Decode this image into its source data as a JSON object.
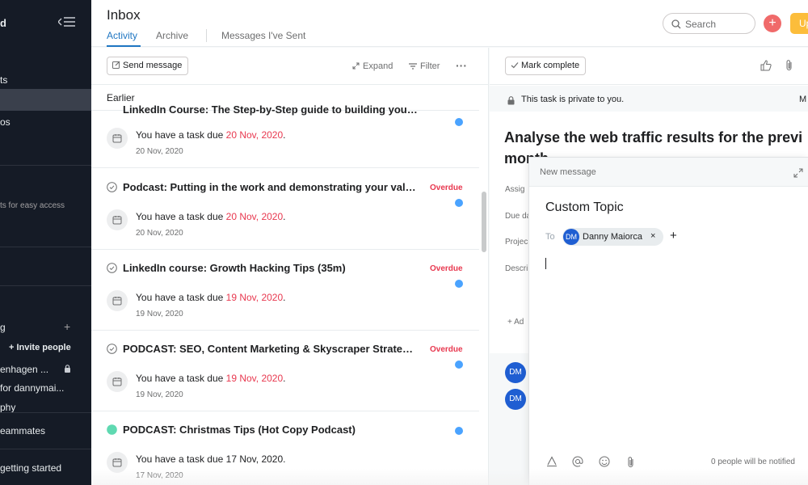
{
  "sidebar": {
    "partial_1": "d",
    "partial_2": "ts",
    "partial_3": "os",
    "partial_4": "ts for easy access",
    "partial_5": "g",
    "invite_label": "Invite people",
    "partial_6": "enhagen ...",
    "partial_7": "for dannymai...",
    "partial_8": "phy",
    "partial_9": "eammates",
    "partial_10": "getting started"
  },
  "header": {
    "title": "Inbox",
    "tabs": [
      {
        "label": "Activity"
      },
      {
        "label": "Archive"
      },
      {
        "label": "Messages I've Sent"
      }
    ],
    "search_placeholder": "Search",
    "upgrade_label": "Up"
  },
  "list_toolbar": {
    "send_message": "Send message",
    "expand": "Expand",
    "filter": "Filter",
    "more": "···"
  },
  "list": {
    "section_label": "Earlier",
    "items": [
      {
        "title": "LinkedIn Course: The Step-by-Step guide to building your li...",
        "overdue": "",
        "text_prefix": "You have a task due ",
        "due": "20 Nov, 2020",
        "text_suffix": ".",
        "date": "20 Nov, 2020"
      },
      {
        "title": "Podcast: Putting in the work and demonstrating your valu...",
        "overdue": "Overdue",
        "text_prefix": "You have a task due ",
        "due": "20 Nov, 2020",
        "text_suffix": ".",
        "date": "20 Nov, 2020"
      },
      {
        "title": "LinkedIn course: Growth Hacking Tips (35m)",
        "overdue": "Overdue",
        "text_prefix": "You have a task due ",
        "due": "19 Nov, 2020",
        "text_suffix": ".",
        "date": "19 Nov, 2020"
      },
      {
        "title": "PODCAST: SEO, Content Marketing & Skyscraper Strategi...",
        "overdue": "Overdue",
        "text_prefix": "You have a task due ",
        "due": "19 Nov, 2020",
        "text_suffix": ".",
        "date": "19 Nov, 2020"
      },
      {
        "title": "PODCAST: Christmas Tips (Hot Copy Podcast)",
        "overdue": "",
        "text_prefix": "You have a task due 17 Nov, 2020.",
        "due": "",
        "text_suffix": "",
        "date": "17 Nov, 2020"
      }
    ]
  },
  "detail": {
    "mark_complete": "Mark complete",
    "private_notice": "This task is private to you.",
    "private_right": "M",
    "title_line1": "Analyse the web traffic results for the previ",
    "title_line2": "month",
    "fields": [
      "Assig",
      "Due da",
      "Projec",
      "Descri"
    ],
    "add_label": "Ad",
    "avatar_initials": "DM"
  },
  "compose": {
    "header": "New message",
    "subject": "Custom Topic",
    "to_label": "To",
    "recipient_initials": "DM",
    "recipient_name": "Danny Maiorca",
    "remove": "×",
    "add": "+",
    "notify_text": "0 people will be notified"
  },
  "colors": {
    "accent_blue": "#1f76c2",
    "overdue_red": "#e8384f",
    "sidebar_bg": "#151b26",
    "avatar_blue": "#1f5ed2",
    "dot_blue": "#4aa3ff",
    "upgrade_yellow": "#fcbd3b",
    "add_coral": "#f06a6a"
  }
}
